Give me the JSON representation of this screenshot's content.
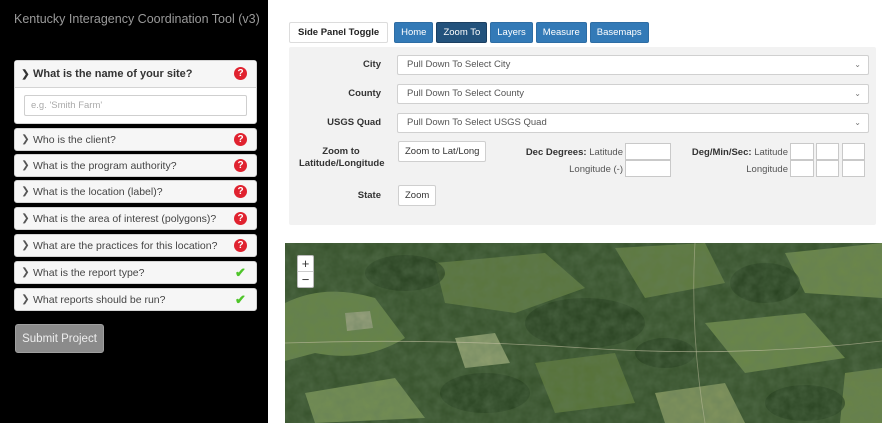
{
  "app": {
    "title": "Kentucky Interagency Coordination Tool (v3)"
  },
  "questions": {
    "open": {
      "label": "What is the name of your site?",
      "status": "incomplete",
      "input_placeholder": "e.g. 'Smith Farm'"
    },
    "items": [
      {
        "label": "Who is the client?",
        "status": "incomplete"
      },
      {
        "label": "What is the program authority?",
        "status": "incomplete"
      },
      {
        "label": "What is the location (label)?",
        "status": "incomplete"
      },
      {
        "label": "What is the area of interest (polygons)?",
        "status": "incomplete"
      },
      {
        "label": "What are the practices for this location?",
        "status": "incomplete"
      },
      {
        "label": "What is the report type?",
        "status": "complete"
      },
      {
        "label": "What reports should be run?",
        "status": "complete"
      }
    ]
  },
  "submit_label": "Submit Project",
  "toolbar": {
    "side_panel_toggle": "Side Panel Toggle",
    "home": "Home",
    "zoom_to": "Zoom To",
    "layers": "Layers",
    "measure": "Measure",
    "basemaps": "Basemaps"
  },
  "zoom_panel": {
    "city_label": "City",
    "city_value": "Pull Down To Select City",
    "county_label": "County",
    "county_value": "Pull Down To Select County",
    "quad_label": "USGS Quad",
    "quad_value": "Pull Down To Select USGS Quad",
    "latlong_label": "Zoom to Latitude/Longitude",
    "latlong_button": "Zoom to Lat/Long",
    "dec_degrees_label": "Dec Degrees:",
    "dec_latitude": "Latitude",
    "dec_longitude": "Longitude (-)",
    "dms_label": "Deg/Min/Sec:",
    "dms_latitude": "Latitude",
    "dms_longitude": "Longitude",
    "state_label": "State",
    "state_button": "Zoom"
  },
  "map": {
    "zoom_in": "+",
    "zoom_out": "−"
  },
  "icons": {
    "incomplete": "question-circle-icon",
    "complete": "check-icon",
    "chevron_right": "chevron-right-icon",
    "chevron_down": "chevron-down-icon"
  },
  "colors": {
    "primary_button": "#337ab7",
    "active_button": "#23527c",
    "incomplete": "#e0222f",
    "complete": "#4fc52a"
  }
}
